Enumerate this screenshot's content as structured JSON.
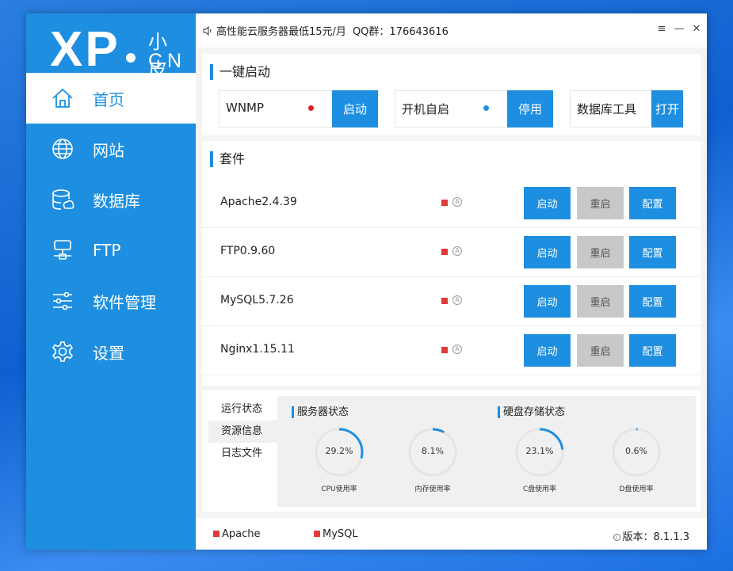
{
  "logo": {
    "xp": "XP",
    "cn_top": "小皮",
    "cn_bottom": "CN"
  },
  "sidebar": {
    "items": [
      {
        "label": "首页",
        "icon": "home-icon",
        "active": true
      },
      {
        "label": "网站",
        "icon": "globe-icon"
      },
      {
        "label": "数据库",
        "icon": "database-icon"
      },
      {
        "label": "FTP",
        "icon": "ftp-icon"
      },
      {
        "label": "软件管理",
        "icon": "sliders-icon"
      },
      {
        "label": "设置",
        "icon": "gear-icon"
      }
    ]
  },
  "titlebar": {
    "notice": "高性能云服务器最低15元/月",
    "qq": "QQ群：176643616",
    "controls": [
      "≡",
      "—",
      "✕"
    ]
  },
  "quickstart": {
    "title": "一键启动",
    "boxes": [
      {
        "label": "WNMP",
        "status_color": "#e02020",
        "button": "启动"
      },
      {
        "label": "开机自启",
        "status_color": "#1e8fe0",
        "button": "停用"
      },
      {
        "label": "数据库工具",
        "button": "打开"
      }
    ]
  },
  "suite": {
    "title": "套件",
    "rows": [
      {
        "name": "Apache2.4.39",
        "auto": "A",
        "start": "启动",
        "restart": "重启",
        "config": "配置"
      },
      {
        "name": "FTP0.9.60",
        "auto": "A",
        "start": "启动",
        "restart": "重启",
        "config": "配置"
      },
      {
        "name": "MySQL5.7.26",
        "auto": "A",
        "start": "启动",
        "restart": "重启",
        "config": "配置"
      },
      {
        "name": "Nginx1.15.11",
        "auto": "A",
        "start": "启动",
        "restart": "重启",
        "config": "配置"
      }
    ]
  },
  "bottom": {
    "tabs": [
      "运行状态",
      "资源信息",
      "日志文件"
    ],
    "server_title": "服务器状态",
    "disk_title": "硬盘存储状态",
    "gauges": [
      {
        "value_text": "29.2%",
        "value": 29.2,
        "label": "CPU使用率"
      },
      {
        "value_text": "8.1%",
        "value": 8.1,
        "label": "内存使用率"
      },
      {
        "value_text": "23.1%",
        "value": 23.1,
        "label": "C盘使用率"
      },
      {
        "value_text": "0.6%",
        "value": 0.6,
        "label": "D盘使用率"
      }
    ]
  },
  "footer": {
    "services": [
      "Apache",
      "MySQL"
    ],
    "version_label": "版本：",
    "version": "8.1.1.3"
  },
  "colors": {
    "accent": "#1e8fe0",
    "stopped": "#e03a3a",
    "disabled": "#c8c8c8"
  }
}
